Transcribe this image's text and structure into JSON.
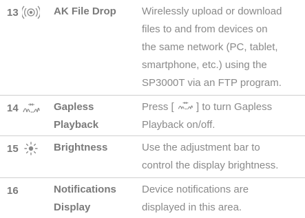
{
  "rows": [
    {
      "number": "13",
      "icon": "wifi-radio-icon",
      "name": "AK File Drop",
      "description_lines": [
        "Wirelessly upload or download",
        "files to and from devices on",
        "the same network (PC, tablet,",
        "smartphone, etc.) using the",
        "SP3000T via an FTP program."
      ]
    },
    {
      "number": "14",
      "icon": "gapless-icon",
      "name_lines": [
        "Gapless",
        "Playback"
      ],
      "description_prefix": "Press [",
      "description_suffix": "] to turn Gapless",
      "description_line2": "Playback on/off."
    },
    {
      "number": "15",
      "icon": "brightness-icon",
      "name": "Brightness",
      "description_lines": [
        "Use the adjustment bar to",
        "control the display brightness."
      ]
    },
    {
      "number": "16",
      "name_lines": [
        "Notifications",
        "Display"
      ],
      "description_lines": [
        "Device notifications are",
        "displayed in this area."
      ]
    }
  ],
  "colors": {
    "text": "#8a8a8a",
    "heading": "#7a7a7a",
    "divider": "#cfcfcf"
  }
}
